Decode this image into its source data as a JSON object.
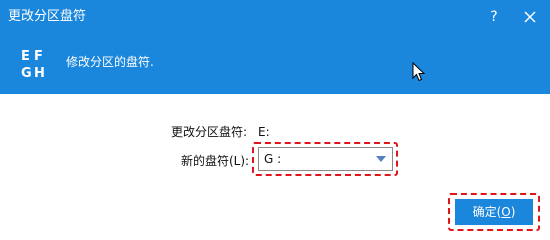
{
  "window": {
    "title": "更改分区盘符",
    "help_label": "?"
  },
  "header": {
    "icon_letters": [
      "E",
      "F",
      "G",
      "H"
    ],
    "text": "修改分区的盘符."
  },
  "form": {
    "current_label": "更改分区盘符:",
    "current_value": "E:",
    "new_label": "新的盘符(L):",
    "new_value": "G :"
  },
  "buttons": {
    "ok_text": "确定(",
    "ok_mnemonic": "O",
    "ok_close": ")"
  },
  "colors": {
    "accent": "#1a86dc",
    "highlight": "#e0151a"
  }
}
